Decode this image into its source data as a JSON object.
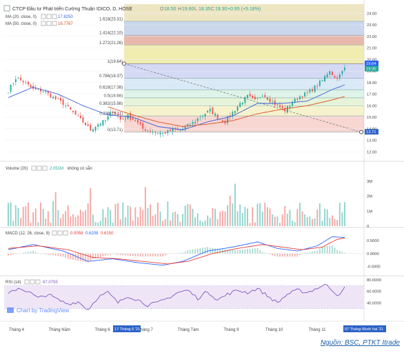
{
  "header": {
    "title": "CTCP Đầu tư Phát triển Cường Thuận IDICO, D, HOSE",
    "o_label": "O",
    "o": "18.50",
    "h_label": "H",
    "h": "19.60",
    "l_label": "L",
    "l": "18.35",
    "c_label": "C",
    "c": "19.30",
    "change": "+0.95 (+5.18%)"
  },
  "ma_legend": [
    {
      "label": "MA (20, close, 0)",
      "value": "17.8250",
      "color": "#3b5ed8"
    },
    {
      "label": "MA (50, close, 0)",
      "value": "16.7767",
      "color": "#d8501e"
    }
  ],
  "volume_legend": {
    "label": "Volume (20)",
    "value": "2.051M",
    "note": "không có sẵn"
  },
  "macd_legend": {
    "label": "MACD (12, 26, close, 9)",
    "v1": "0.0058",
    "v2": "0.6208",
    "v3": "0.6150"
  },
  "rsi_legend": {
    "label": "RSI (14)",
    "value": "67.0755"
  },
  "watermark": "Chart by TradingView",
  "date_badge_left": "17 Tháng 6 '21",
  "date_badge_right": "07 Tháng Mười hai '21",
  "source": "Nguồn: BSC, PTKT Itrade",
  "colors": {
    "up": "#26a69a",
    "down": "#ef5350",
    "ma20": "#3b5ed8",
    "ma50": "#d8501e",
    "rsi": "#7e57c2",
    "macd": "#2962ff",
    "signal": "#e53935"
  },
  "chart_data": {
    "type": "candlestick",
    "price_axis": {
      "ticks": [
        "24.00",
        "23.00",
        "22.00",
        "21.00",
        "20.00",
        "19.00",
        "18.00",
        "17.00",
        "16.00",
        "15.00",
        "14.00",
        "13.00",
        "12.00"
      ],
      "ylim": [
        11.3,
        24.8
      ],
      "last_high_label": "19.64",
      "last_close_label": "19.30",
      "low_label": "13.71"
    },
    "x_axis": {
      "labels": [
        "Tháng 4",
        "Tháng Năm",
        "Tháng 6",
        "Tháng 7",
        "Tháng Tám",
        "Tháng 9",
        "Tháng 10",
        "Tháng 11"
      ]
    },
    "fibonacci": [
      {
        "ratio": "1.618",
        "price": "23.31"
      },
      {
        "ratio": "1.414",
        "price": "22.10"
      },
      {
        "ratio": "1.272",
        "price": "21.26"
      },
      {
        "ratio": "1",
        "price": "19.64"
      },
      {
        "ratio": "0.786",
        "price": "18.37"
      },
      {
        "ratio": "0.618",
        "price": "17.38"
      },
      {
        "ratio": "0.5",
        "price": "16.68"
      },
      {
        "ratio": "0.382",
        "price": "15.98"
      },
      {
        "ratio": "0.236",
        "price": "15.11"
      },
      {
        "ratio": "0",
        "price": "13.71"
      }
    ],
    "close_anchors": [
      [
        0,
        17.3
      ],
      [
        3,
        18.4
      ],
      [
        6,
        18.1
      ],
      [
        10,
        17.4
      ],
      [
        14,
        17.3
      ],
      [
        18,
        16.7
      ],
      [
        22,
        16.2
      ],
      [
        26,
        15.4
      ],
      [
        30,
        14.6
      ],
      [
        33,
        13.9
      ],
      [
        36,
        14.4
      ],
      [
        39,
        14.7
      ],
      [
        42,
        15.6
      ],
      [
        45,
        14.8
      ],
      [
        48,
        15.1
      ],
      [
        51,
        14.7
      ],
      [
        54,
        14.0
      ],
      [
        58,
        13.8
      ],
      [
        62,
        13.6
      ],
      [
        66,
        13.9
      ],
      [
        70,
        14.0
      ],
      [
        74,
        14.5
      ],
      [
        78,
        15.2
      ],
      [
        81,
        15.6
      ],
      [
        84,
        15.0
      ],
      [
        87,
        14.6
      ],
      [
        90,
        15.4
      ],
      [
        93,
        16.2
      ],
      [
        96,
        16.8
      ],
      [
        99,
        16.4
      ],
      [
        102,
        17.0
      ],
      [
        105,
        16.5
      ],
      [
        108,
        16.0
      ],
      [
        111,
        15.6
      ],
      [
        114,
        16.3
      ],
      [
        117,
        16.8
      ],
      [
        120,
        17.1
      ],
      [
        123,
        17.6
      ],
      [
        126,
        18.2
      ],
      [
        129,
        19.1
      ],
      [
        131,
        18.4
      ],
      [
        133,
        18.6
      ],
      [
        135,
        19.3
      ]
    ],
    "ma20": {
      "name": "MA (20, close, 0)",
      "anchors": [
        [
          0,
          16.7
        ],
        [
          10,
          17.6
        ],
        [
          20,
          17.0
        ],
        [
          30,
          16.0
        ],
        [
          40,
          15.2
        ],
        [
          50,
          15.0
        ],
        [
          60,
          14.2
        ],
        [
          70,
          13.9
        ],
        [
          80,
          14.6
        ],
        [
          90,
          15.1
        ],
        [
          100,
          16.2
        ],
        [
          110,
          16.2
        ],
        [
          120,
          16.4
        ],
        [
          130,
          17.4
        ],
        [
          135,
          17.8
        ]
      ]
    },
    "ma50": {
      "name": "MA (50, close, 0)",
      "anchors": [
        [
          40,
          15.9
        ],
        [
          50,
          15.2
        ],
        [
          60,
          14.6
        ],
        [
          70,
          14.2
        ],
        [
          80,
          14.4
        ],
        [
          90,
          14.7
        ],
        [
          100,
          15.3
        ],
        [
          110,
          15.7
        ],
        [
          120,
          16.0
        ],
        [
          130,
          16.5
        ],
        [
          135,
          16.8
        ]
      ]
    },
    "volume": {
      "ticks": [
        "3M",
        "2M",
        "1M",
        "0"
      ],
      "ylim": [
        0,
        3.5
      ]
    },
    "macd": {
      "ticks": [
        "0.5000",
        "0.0000",
        "-0.5000"
      ],
      "ylim": [
        -0.8,
        0.9
      ],
      "macd_anchors": [
        [
          0,
          0.15
        ],
        [
          10,
          0.35
        ],
        [
          22,
          0.1
        ],
        [
          32,
          -0.3
        ],
        [
          42,
          -0.2
        ],
        [
          52,
          -0.35
        ],
        [
          62,
          -0.45
        ],
        [
          70,
          -0.3
        ],
        [
          80,
          0.1
        ],
        [
          90,
          0.25
        ],
        [
          100,
          0.45
        ],
        [
          108,
          0.2
        ],
        [
          116,
          0.1
        ],
        [
          124,
          0.3
        ],
        [
          130,
          0.65
        ],
        [
          135,
          0.62
        ]
      ],
      "signal_anchors": [
        [
          0,
          0.2
        ],
        [
          12,
          0.3
        ],
        [
          24,
          0.15
        ],
        [
          34,
          -0.15
        ],
        [
          44,
          -0.2
        ],
        [
          54,
          -0.3
        ],
        [
          64,
          -0.4
        ],
        [
          72,
          -0.3
        ],
        [
          82,
          0.0
        ],
        [
          92,
          0.2
        ],
        [
          102,
          0.35
        ],
        [
          110,
          0.25
        ],
        [
          118,
          0.15
        ],
        [
          126,
          0.25
        ],
        [
          132,
          0.55
        ],
        [
          135,
          0.6
        ]
      ]
    },
    "rsi": {
      "ticks": [
        "80.0000",
        "60.0000",
        "40.0000"
      ],
      "ylim": [
        15,
        85
      ],
      "band": [
        30,
        70
      ],
      "anchors": [
        [
          0,
          55
        ],
        [
          4,
          66
        ],
        [
          8,
          60
        ],
        [
          12,
          48
        ],
        [
          16,
          55
        ],
        [
          20,
          45
        ],
        [
          24,
          38
        ],
        [
          28,
          42
        ],
        [
          32,
          28
        ],
        [
          36,
          50
        ],
        [
          40,
          58
        ],
        [
          44,
          40
        ],
        [
          48,
          52
        ],
        [
          52,
          45
        ],
        [
          56,
          36
        ],
        [
          60,
          40
        ],
        [
          64,
          48
        ],
        [
          68,
          58
        ],
        [
          72,
          62
        ],
        [
          76,
          48
        ],
        [
          80,
          60
        ],
        [
          84,
          45
        ],
        [
          88,
          55
        ],
        [
          92,
          62
        ],
        [
          96,
          58
        ],
        [
          100,
          65
        ],
        [
          104,
          52
        ],
        [
          108,
          40
        ],
        [
          112,
          55
        ],
        [
          116,
          62
        ],
        [
          120,
          58
        ],
        [
          124,
          66
        ],
        [
          128,
          72
        ],
        [
          131,
          58
        ],
        [
          133,
          52
        ],
        [
          135,
          67
        ]
      ]
    }
  }
}
